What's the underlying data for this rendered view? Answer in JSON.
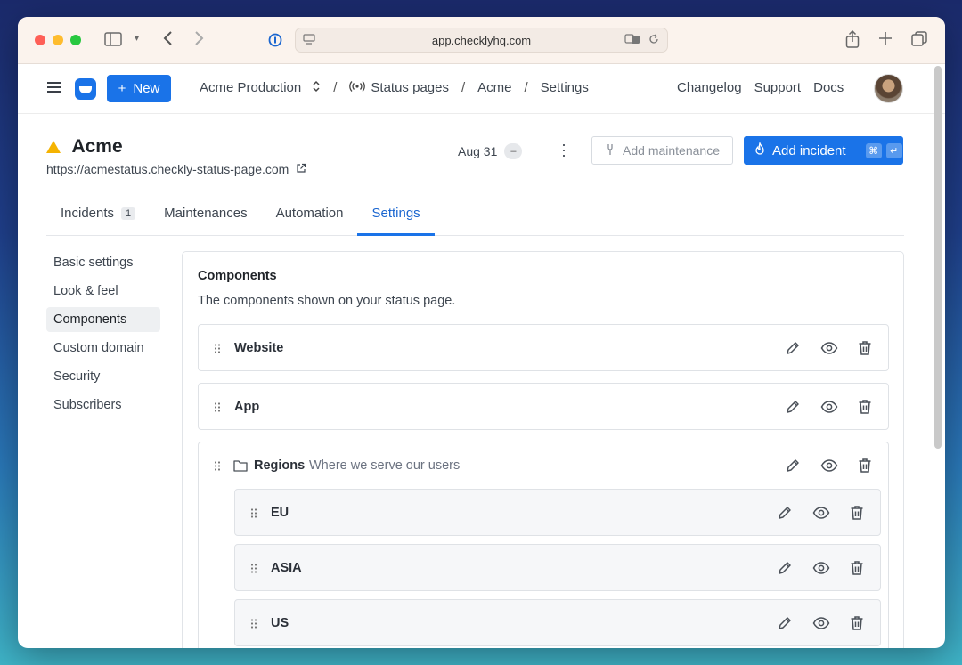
{
  "browser": {
    "url": "app.checklyhq.com"
  },
  "appbar": {
    "new_label": "New",
    "breadcrumb": {
      "account": "Acme Production",
      "section": "Status pages",
      "page": "Acme",
      "current": "Settings"
    },
    "links": [
      "Changelog",
      "Support",
      "Docs"
    ]
  },
  "page": {
    "title": "Acme",
    "url": "https://acmestatus.checkly-status-page.com",
    "date": "Aug 31",
    "date_pill": "–",
    "add_maintenance_label": "Add maintenance",
    "add_incident_label": "Add incident",
    "shortcut_keys": [
      "⌘",
      "↵"
    ]
  },
  "tabs": [
    {
      "label": "Incidents",
      "count": "1"
    },
    {
      "label": "Maintenances"
    },
    {
      "label": "Automation"
    },
    {
      "label": "Settings",
      "active": true
    }
  ],
  "sidenav": [
    {
      "label": "Basic settings"
    },
    {
      "label": "Look & feel"
    },
    {
      "label": "Components",
      "active": true
    },
    {
      "label": "Custom domain"
    },
    {
      "label": "Security"
    },
    {
      "label": "Subscribers"
    }
  ],
  "components": {
    "title": "Components",
    "description": "The components shown on your status page.",
    "items": [
      {
        "name": "Website"
      },
      {
        "name": "App"
      },
      {
        "name": "Regions",
        "description": "Where we serve our users",
        "children": [
          {
            "name": "EU"
          },
          {
            "name": "ASIA"
          },
          {
            "name": "US"
          }
        ]
      }
    ]
  },
  "colors": {
    "accent": "#1a73e8",
    "warning": "#f5b301"
  }
}
